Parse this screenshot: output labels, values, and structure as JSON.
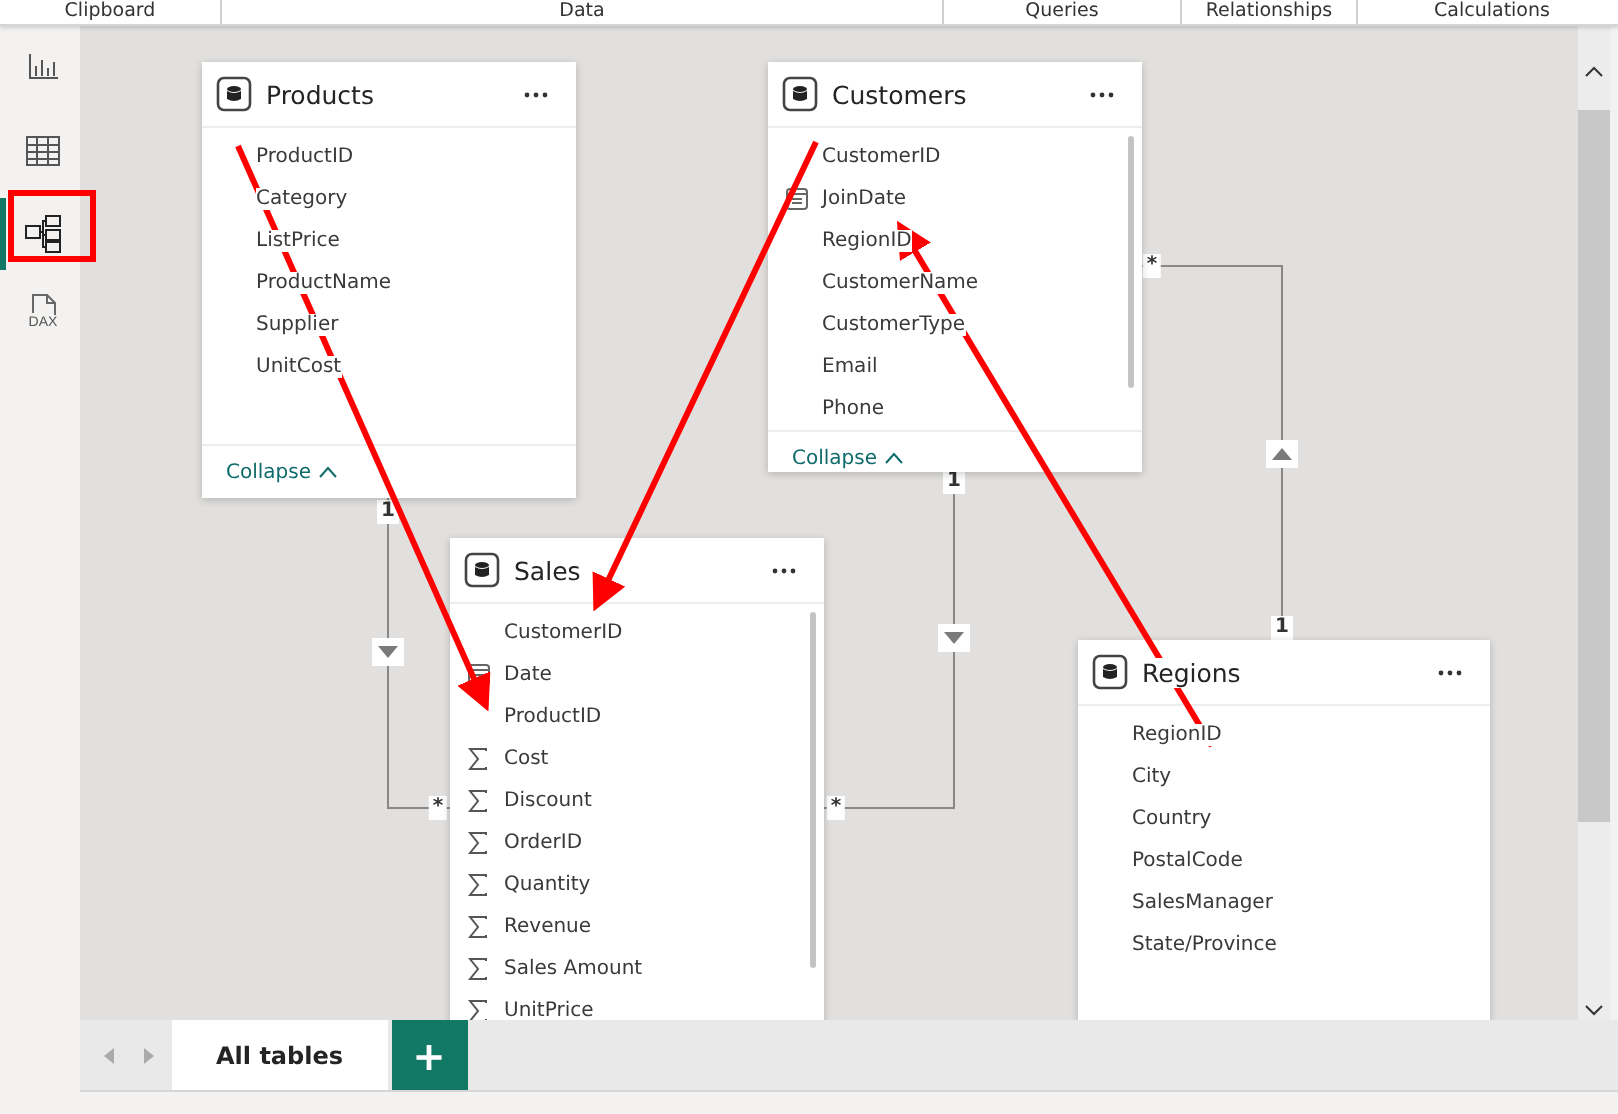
{
  "ribbon_groups": [
    "Clipboard",
    "Data",
    "Queries",
    "Relationships",
    "Calculations"
  ],
  "sidebar": {
    "items": [
      {
        "kind": "report",
        "selected": false
      },
      {
        "kind": "table",
        "selected": false
      },
      {
        "kind": "model",
        "selected": true
      },
      {
        "kind": "dax",
        "selected": false,
        "label": "DAX"
      }
    ]
  },
  "tables": [
    {
      "name": "Products",
      "collapse": "Collapse",
      "fields": [
        {
          "name": "ProductID",
          "kind": "plain"
        },
        {
          "name": "Category",
          "kind": "plain"
        },
        {
          "name": "ListPrice",
          "kind": "plain"
        },
        {
          "name": "ProductName",
          "kind": "plain"
        },
        {
          "name": "Supplier",
          "kind": "plain"
        },
        {
          "name": "UnitCost",
          "kind": "plain"
        }
      ]
    },
    {
      "name": "Customers",
      "collapse": "Collapse",
      "fields": [
        {
          "name": "CustomerID",
          "kind": "plain"
        },
        {
          "name": "JoinDate",
          "kind": "date"
        },
        {
          "name": "RegionID",
          "kind": "plain"
        },
        {
          "name": "CustomerName",
          "kind": "plain"
        },
        {
          "name": "CustomerType",
          "kind": "plain"
        },
        {
          "name": "Email",
          "kind": "plain"
        },
        {
          "name": "Phone",
          "kind": "plain"
        }
      ]
    },
    {
      "name": "Sales",
      "fields": [
        {
          "name": "CustomerID",
          "kind": "plain"
        },
        {
          "name": "Date",
          "kind": "date"
        },
        {
          "name": "ProductID",
          "kind": "plain"
        },
        {
          "name": "Cost",
          "kind": "sum"
        },
        {
          "name": "Discount",
          "kind": "sum"
        },
        {
          "name": "OrderID",
          "kind": "sum"
        },
        {
          "name": "Quantity",
          "kind": "sum"
        },
        {
          "name": "Revenue",
          "kind": "sum"
        },
        {
          "name": "Sales Amount",
          "kind": "sum"
        },
        {
          "name": "UnitPrice",
          "kind": "sum"
        }
      ]
    },
    {
      "name": "Regions",
      "fields": [
        {
          "name": "RegionID",
          "kind": "plain"
        },
        {
          "name": "City",
          "kind": "plain"
        },
        {
          "name": "Country",
          "kind": "plain"
        },
        {
          "name": "PostalCode",
          "kind": "plain"
        },
        {
          "name": "SalesManager",
          "kind": "plain"
        },
        {
          "name": "State/Province",
          "kind": "plain"
        }
      ]
    }
  ],
  "relationships": [
    {
      "one": "1",
      "many": "*",
      "filter_up": false
    },
    {
      "one": "1",
      "many": "*",
      "filter_up": false
    },
    {
      "one": "1",
      "many": "*",
      "filter_up": true
    }
  ],
  "page_tabs": [
    {
      "label": "All tables",
      "selected": true
    }
  ],
  "add_button": "+"
}
